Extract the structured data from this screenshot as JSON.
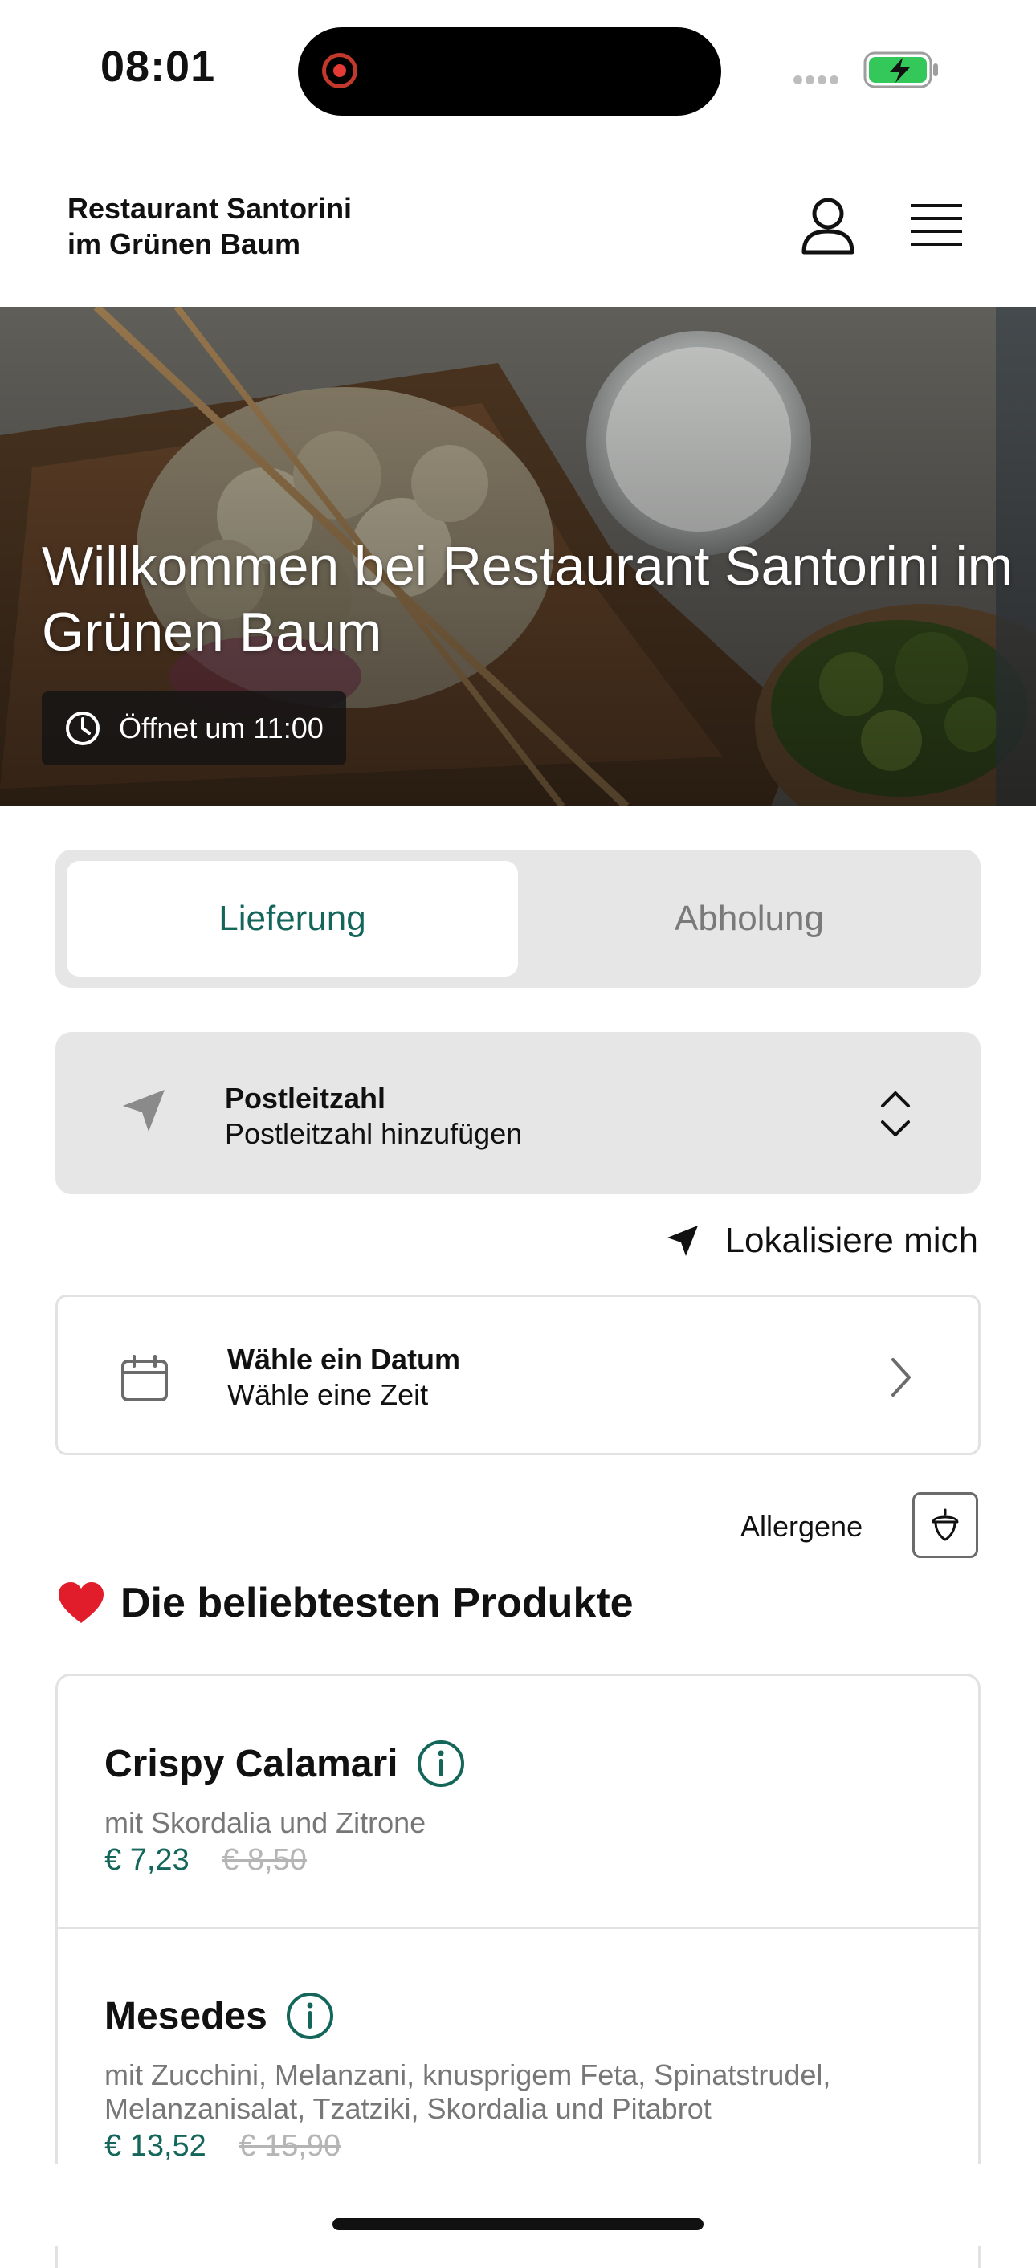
{
  "status_bar": {
    "time": "08:01"
  },
  "header": {
    "brand_line1": "Restaurant Santorini",
    "brand_line2": "im Grünen Baum"
  },
  "hero": {
    "title": "Willkommen bei Restaurant Santorini im Grünen Baum",
    "opening": "Öffnet um 11:00"
  },
  "mode_toggle": {
    "delivery": "Lieferung",
    "pickup": "Abholung",
    "selected": "delivery"
  },
  "postcode": {
    "title": "Postleitzahl",
    "subtitle": "Postleitzahl hinzufügen"
  },
  "locate": {
    "label": "Lokalisiere mich"
  },
  "date": {
    "title": "Wähle ein Datum",
    "subtitle": "Wähle eine Zeit"
  },
  "allergens": {
    "label": "Allergene"
  },
  "popular": {
    "heading": "Die beliebtesten Produkte",
    "products": [
      {
        "name": "Crispy Calamari",
        "description": "mit Skordalia und Zitrone",
        "price": "€ 7,23",
        "old_price": "€ 8,50"
      },
      {
        "name": "Mesedes",
        "description": "mit Zucchini, Melanzani, knusprigem Feta, Spinatstrudel, Melanzanisalat, Tzatziki, Skordalia und Pitabrot",
        "price": "€ 13,52",
        "old_price": "€ 15,90"
      }
    ]
  },
  "colors": {
    "accent": "#14665a",
    "card_bg": "#e6e6e6",
    "battery": "#34c759"
  },
  "icons": [
    "user-icon",
    "hamburger-menu-icon",
    "clock-icon",
    "navigation-arrow-icon",
    "chevron-up-down-icon",
    "calendar-icon",
    "chevron-right-icon",
    "acorn-icon",
    "heart-icon",
    "info-icon"
  ]
}
